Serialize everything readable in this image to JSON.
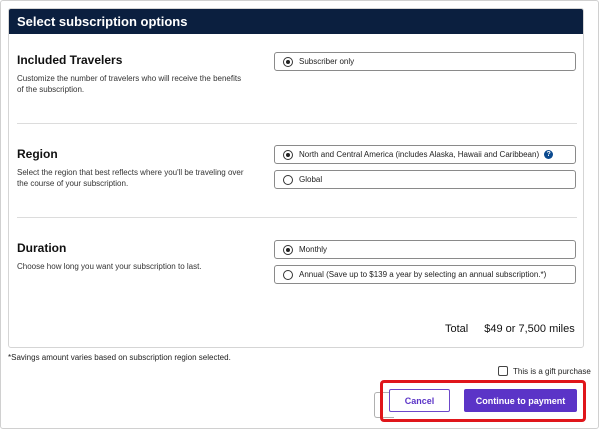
{
  "panel": {
    "title": "Select subscription options"
  },
  "travelers": {
    "title": "Included Travelers",
    "description": "Customize the number of travelers who will receive the benefits of the subscription.",
    "options": [
      {
        "label": "Subscriber only",
        "selected": true
      }
    ]
  },
  "region": {
    "title": "Region",
    "description": "Select the region that best reflects where you'll be traveling over the course of your subscription.",
    "options": [
      {
        "label": "North and Central America (includes Alaska, Hawaii and Caribbean)",
        "selected": true,
        "icon": "help-icon"
      },
      {
        "label": "Global",
        "selected": false
      }
    ]
  },
  "duration": {
    "title": "Duration",
    "description": "Choose how long you want your subscription to last.",
    "options": [
      {
        "label": "Monthly",
        "selected": true
      },
      {
        "label": "Annual (Save up to $139 a year by selecting an annual subscription.*)",
        "selected": false
      }
    ]
  },
  "total": {
    "label": "Total",
    "value": "$49 or 7,500 miles"
  },
  "footnote": "*Savings amount varies based on subscription region selected.",
  "gift": {
    "label": "This is a gift purchase",
    "checked": false
  },
  "actions": {
    "cancel_label": "Cancel",
    "continue_label": "Continue to payment"
  },
  "colors": {
    "header_bg": "#0b1f3f",
    "primary": "#5b34c7",
    "highlight": "#e0161b"
  }
}
